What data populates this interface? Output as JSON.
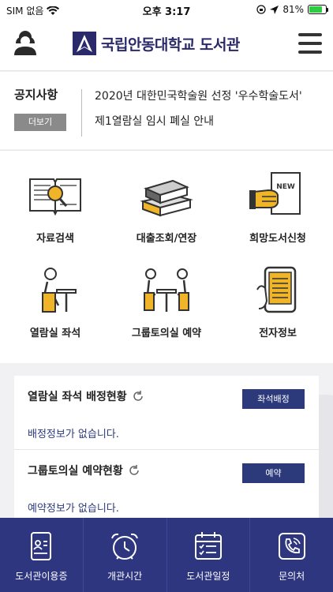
{
  "status_bar": {
    "carrier": "SIM 없음",
    "time": "오후 3:17",
    "battery_text": "81%",
    "battery_level": 0.81
  },
  "header": {
    "logo_text": "국립안동대학교 도서관"
  },
  "notice": {
    "title": "공지사항",
    "more_label": "더보기",
    "items": [
      "2020년 대한민국학술원 선정 '우수학술도서'",
      "제1열람실 임시 폐실 안내"
    ]
  },
  "menu": [
    {
      "label": "자료검색",
      "icon": "book-search-icon"
    },
    {
      "label": "대출조회/연장",
      "icon": "books-stack-icon"
    },
    {
      "label": "희망도서신청",
      "icon": "new-book-hand-icon"
    },
    {
      "label": "열람실 좌석",
      "icon": "reading-seat-icon"
    },
    {
      "label": "그룹토의실 예약",
      "icon": "group-room-icon"
    },
    {
      "label": "전자정보",
      "icon": "ebook-phone-icon"
    }
  ],
  "status_panel": {
    "seat": {
      "title": "열람실 좌석 배정현황",
      "button": "좌석배정",
      "message": "배정정보가 없습니다."
    },
    "room": {
      "title": "그룹토의실 예약현황",
      "button": "예약",
      "message": "예약정보가 없습니다."
    }
  },
  "bottom_nav": [
    {
      "label": "도서관이용증",
      "icon": "library-card-icon"
    },
    {
      "label": "개관시간",
      "icon": "alarm-clock-icon"
    },
    {
      "label": "도서관일정",
      "icon": "calendar-icon"
    },
    {
      "label": "문의처",
      "icon": "phone-icon"
    }
  ],
  "colors": {
    "brand": "#2c3a7b",
    "nav_bg": "#2e3680",
    "accent_yellow": "#f0b429"
  }
}
